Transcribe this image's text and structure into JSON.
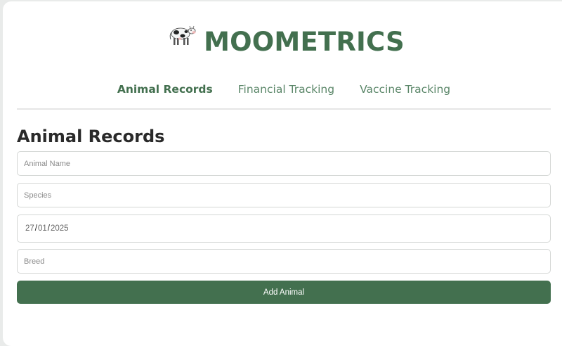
{
  "app": {
    "title": "MOOMETRICS",
    "icon": "cow-icon"
  },
  "tabs": [
    {
      "label": "Animal Records",
      "active": true
    },
    {
      "label": "Financial Tracking",
      "active": false
    },
    {
      "label": "Vaccine Tracking",
      "active": false
    }
  ],
  "form": {
    "heading": "Animal Records",
    "animal_name": {
      "placeholder": "Animal Name",
      "value": ""
    },
    "species": {
      "placeholder": "Species",
      "value": ""
    },
    "date": {
      "day": "27",
      "month": "01",
      "year": "2025"
    },
    "breed": {
      "placeholder": "Breed",
      "value": ""
    },
    "submit_label": "Add Animal"
  },
  "colors": {
    "brand": "#43704f",
    "tab_inactive": "#5a8668"
  }
}
